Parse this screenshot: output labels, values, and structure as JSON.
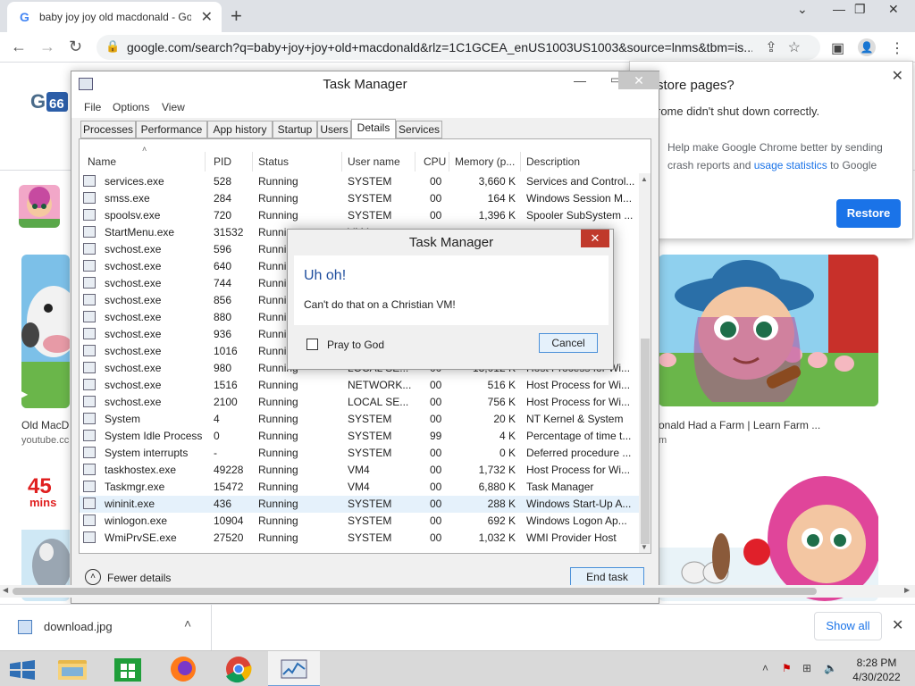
{
  "browser": {
    "tab_title": "baby joy joy old macdonald - Go",
    "tab_favicon": "G",
    "url": "google.com/search?q=baby+joy+joy+old+macdonald&rlz=1C1GCEA_enUS1003US1003&source=lnms&tbm=is...",
    "accent": "#1a73e8"
  },
  "page": {
    "left_card_title": "Old MacD",
    "left_card_source": "youtube.cc",
    "right_card_title": "onald Had a Farm | Learn Farm ...",
    "right_card_source": "m",
    "badge_45": "45",
    "badge_mins": "mins"
  },
  "restore": {
    "title": "store pages?",
    "message": "rome didn't shut down correctly.",
    "help_prefix": "Help make Google Chrome better by sending crash reports and ",
    "help_link": "usage statistics",
    "help_suffix": " to Google",
    "button": "Restore"
  },
  "taskmanager": {
    "title": "Task Manager",
    "menu": [
      "File",
      "Options",
      "View"
    ],
    "tabs": [
      "Processes",
      "Performance",
      "App history",
      "Startup",
      "Users",
      "Details",
      "Services"
    ],
    "active_tab": "Details",
    "columns": [
      "Name",
      "PID",
      "Status",
      "User name",
      "CPU",
      "Memory (p...",
      "Description"
    ],
    "rows": [
      {
        "name": "services.exe",
        "pid": "528",
        "status": "Running",
        "user": "SYSTEM",
        "cpu": "00",
        "mem": "3,660 K",
        "desc": "Services and Control..."
      },
      {
        "name": "smss.exe",
        "pid": "284",
        "status": "Running",
        "user": "SYSTEM",
        "cpu": "00",
        "mem": "164 K",
        "desc": "Windows Session M..."
      },
      {
        "name": "spoolsv.exe",
        "pid": "720",
        "status": "Running",
        "user": "SYSTEM",
        "cpu": "00",
        "mem": "1,396 K",
        "desc": "Spooler SubSystem ..."
      },
      {
        "name": "StartMenu.exe",
        "pid": "31532",
        "status": "Runni",
        "user": "VM4",
        "cpu": "",
        "mem": "",
        "desc": ""
      },
      {
        "name": "svchost.exe",
        "pid": "596",
        "status": "Runni",
        "user": "",
        "cpu": "",
        "mem": "",
        "desc": ""
      },
      {
        "name": "svchost.exe",
        "pid": "640",
        "status": "Runni",
        "user": "",
        "cpu": "",
        "mem": "",
        "desc": ""
      },
      {
        "name": "svchost.exe",
        "pid": "744",
        "status": "Runni",
        "user": "",
        "cpu": "",
        "mem": "",
        "desc": ""
      },
      {
        "name": "svchost.exe",
        "pid": "856",
        "status": "Runni",
        "user": "",
        "cpu": "",
        "mem": "",
        "desc": ""
      },
      {
        "name": "svchost.exe",
        "pid": "880",
        "status": "Runni",
        "user": "",
        "cpu": "",
        "mem": "",
        "desc": ""
      },
      {
        "name": "svchost.exe",
        "pid": "936",
        "status": "Runni",
        "user": "",
        "cpu": "",
        "mem": "",
        "desc": ""
      },
      {
        "name": "svchost.exe",
        "pid": "1016",
        "status": "Runni",
        "user": "",
        "cpu": "",
        "mem": "",
        "desc": ""
      },
      {
        "name": "svchost.exe",
        "pid": "980",
        "status": "Running",
        "user": "LOCAL SE...",
        "cpu": "00",
        "mem": "13,012 K",
        "desc": "Host Process for Wi..."
      },
      {
        "name": "svchost.exe",
        "pid": "1516",
        "status": "Running",
        "user": "NETWORK...",
        "cpu": "00",
        "mem": "516 K",
        "desc": "Host Process for Wi..."
      },
      {
        "name": "svchost.exe",
        "pid": "2100",
        "status": "Running",
        "user": "LOCAL SE...",
        "cpu": "00",
        "mem": "756 K",
        "desc": "Host Process for Wi..."
      },
      {
        "name": "System",
        "pid": "4",
        "status": "Running",
        "user": "SYSTEM",
        "cpu": "00",
        "mem": "20 K",
        "desc": "NT Kernel & System"
      },
      {
        "name": "System Idle Process",
        "pid": "0",
        "status": "Running",
        "user": "SYSTEM",
        "cpu": "99",
        "mem": "4 K",
        "desc": "Percentage of time t..."
      },
      {
        "name": "System interrupts",
        "pid": "-",
        "status": "Running",
        "user": "SYSTEM",
        "cpu": "00",
        "mem": "0 K",
        "desc": "Deferred procedure ..."
      },
      {
        "name": "taskhostex.exe",
        "pid": "49228",
        "status": "Running",
        "user": "VM4",
        "cpu": "00",
        "mem": "1,732 K",
        "desc": "Host Process for Wi..."
      },
      {
        "name": "Taskmgr.exe",
        "pid": "15472",
        "status": "Running",
        "user": "VM4",
        "cpu": "00",
        "mem": "6,880 K",
        "desc": "Task Manager"
      },
      {
        "name": "wininit.exe",
        "pid": "436",
        "status": "Running",
        "user": "SYSTEM",
        "cpu": "00",
        "mem": "288 K",
        "desc": "Windows Start-Up A..."
      },
      {
        "name": "winlogon.exe",
        "pid": "10904",
        "status": "Running",
        "user": "SYSTEM",
        "cpu": "00",
        "mem": "692 K",
        "desc": "Windows Logon Ap..."
      },
      {
        "name": "WmiPrvSE.exe",
        "pid": "27520",
        "status": "Running",
        "user": "SYSTEM",
        "cpu": "00",
        "mem": "1,032 K",
        "desc": "WMI Provider Host"
      }
    ],
    "fewer_details": "Fewer details",
    "end_task": "End task"
  },
  "dialog": {
    "title": "Task Manager",
    "heading": "Uh oh!",
    "message": "Can't do that on a Christian VM!",
    "checkbox_label": "Pray to God",
    "cancel": "Cancel"
  },
  "shelf": {
    "file": "download.jpg",
    "show_all": "Show all"
  },
  "taskbar": {
    "time": "8:28 PM",
    "date": "4/30/2022"
  }
}
